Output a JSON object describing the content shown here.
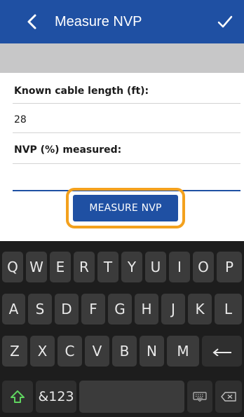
{
  "header": {
    "title": "Measure NVP",
    "back_icon": "chevron-left-icon",
    "confirm_icon": "checkmark-icon",
    "background": "#1f50a3"
  },
  "form": {
    "cable_length_label": "Known cable length (ft):",
    "cable_length_value": "28",
    "nvp_label": "NVP (%) measured:",
    "nvp_value": ""
  },
  "action": {
    "measure_button_label": "MEASURE NVP",
    "highlight_color": "#f3a11e"
  },
  "keyboard": {
    "row1": [
      "Q",
      "W",
      "E",
      "R",
      "T",
      "Y",
      "U",
      "I",
      "O",
      "P"
    ],
    "row2": [
      "A",
      "S",
      "D",
      "F",
      "G",
      "H",
      "J",
      "K",
      "L"
    ],
    "row3": [
      "Z",
      "X",
      "C",
      "V",
      "B",
      "N",
      "M"
    ],
    "symbols_label": "&123",
    "shift_icon": "shift-arrow-icon",
    "enter_icon": "enter-arrow-icon",
    "keyboard_icon": "keyboard-icon",
    "backspace_icon": "backspace-icon"
  }
}
